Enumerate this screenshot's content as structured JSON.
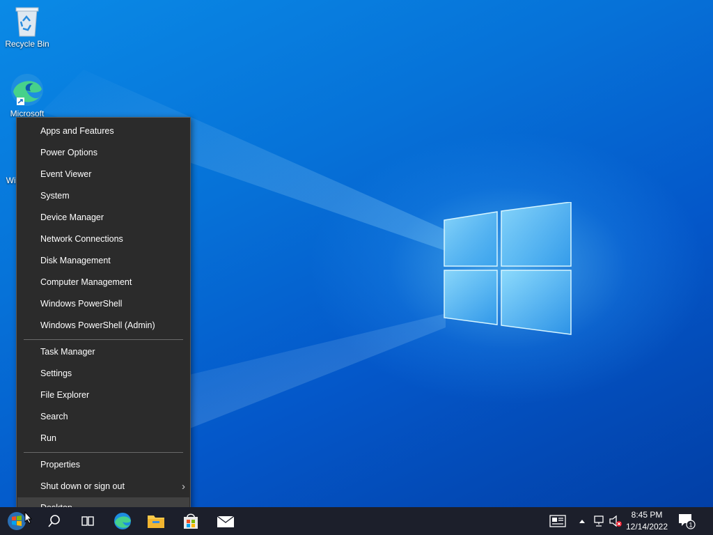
{
  "desktop": {
    "icons": [
      {
        "label": "Recycle Bin",
        "icon": "recycle-bin-icon"
      },
      {
        "label": "Microsoft",
        "icon": "edge-icon"
      },
      {
        "label": "Win",
        "icon": "windows-installer-icon"
      }
    ]
  },
  "context_menu": {
    "groups": [
      [
        "Apps and Features",
        "Power Options",
        "Event Viewer",
        "System",
        "Device Manager",
        "Network Connections",
        "Disk Management",
        "Computer Management",
        "Windows PowerShell",
        "Windows PowerShell (Admin)"
      ],
      [
        "Task Manager",
        "Settings",
        "File Explorer",
        "Search",
        "Run"
      ],
      [
        "Properties",
        "Shut down or sign out",
        "Desktop"
      ]
    ],
    "highlighted": "Desktop",
    "submenu_item": "Shut down or sign out"
  },
  "taskbar": {
    "apps": [
      "start-icon",
      "search-icon",
      "task-view-icon",
      "edge-icon",
      "file-explorer-icon",
      "store-icon",
      "mail-icon"
    ],
    "tray": [
      "news-icon",
      "show-hidden-icon",
      "network-icon",
      "volume-muted-icon"
    ],
    "clock": {
      "time": "8:45 PM",
      "date": "12/14/2022"
    },
    "notifications": {
      "count": "1"
    }
  },
  "colors": {
    "menu_bg": "#2b2b2b",
    "menu_highlight": "#414141",
    "taskbar_bg": "#1c1f2b",
    "desktop_accent": "#0672d8"
  }
}
